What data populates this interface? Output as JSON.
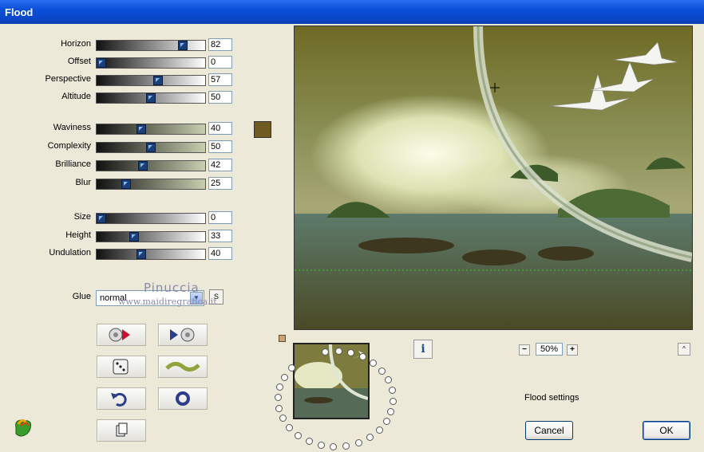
{
  "window": {
    "title": "Flood"
  },
  "sliders_group1": [
    {
      "label": "Horizon",
      "value": "82",
      "level": 0.82
    },
    {
      "label": "Offset",
      "value": "0",
      "level": 0.0
    },
    {
      "label": "Perspective",
      "value": "57",
      "level": 0.57
    },
    {
      "label": "Altitude",
      "value": "50",
      "level": 0.5
    }
  ],
  "sliders_group2": [
    {
      "label": "Waviness",
      "value": "40",
      "level": 0.4
    },
    {
      "label": "Complexity",
      "value": "50",
      "level": 0.5
    },
    {
      "label": "Brilliance",
      "value": "42",
      "level": 0.42
    },
    {
      "label": "Blur",
      "value": "25",
      "level": 0.25
    }
  ],
  "sliders_group3": [
    {
      "label": "Size",
      "value": "0",
      "level": 0.0
    },
    {
      "label": "Height",
      "value": "33",
      "level": 0.33
    },
    {
      "label": "Undulation",
      "value": "40",
      "level": 0.4
    }
  ],
  "color_swatch": "#6f5a24",
  "glue": {
    "label": "Glue",
    "value": "normal",
    "s_button": "S"
  },
  "watermark": {
    "line1": "Pinuccia",
    "line2": "www.maidiregrafica.it"
  },
  "zoom": {
    "value": "50%",
    "minus": "−",
    "plus": "+"
  },
  "info_button": "i",
  "up_button": "^",
  "settings_label": "Flood settings",
  "buttons": {
    "cancel": "Cancel",
    "ok": "OK"
  }
}
